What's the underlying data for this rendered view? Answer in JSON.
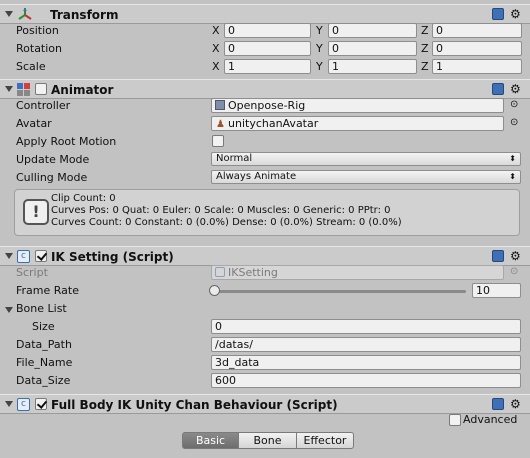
{
  "transform": {
    "title": "Transform",
    "rows": [
      {
        "label": "Position",
        "x": "0",
        "y": "0",
        "z": "0"
      },
      {
        "label": "Rotation",
        "x": "0",
        "y": "0",
        "z": "0"
      },
      {
        "label": "Scale",
        "x": "1",
        "y": "1",
        "z": "1"
      }
    ]
  },
  "axes": {
    "x": "X",
    "y": "Y",
    "z": "Z"
  },
  "animator": {
    "title": "Animator",
    "controller_label": "Controller",
    "controller_value": "Openpose-Rig",
    "avatar_label": "Avatar",
    "avatar_value": "unitychanAvatar",
    "apply_root_motion_label": "Apply Root Motion",
    "update_mode_label": "Update Mode",
    "update_mode_value": "Normal",
    "culling_mode_label": "Culling Mode",
    "culling_mode_value": "Always Animate",
    "info": {
      "line1": "Clip Count: 0",
      "line2": "Curves Pos: 0 Quat: 0 Euler: 0 Scale: 0 Muscles: 0 Generic: 0 PPtr: 0",
      "line3": "Curves Count: 0 Constant: 0 (0.0%) Dense: 0 (0.0%) Stream: 0 (0.0%)"
    }
  },
  "ik": {
    "title": "IK Setting (Script)",
    "script_label": "Script",
    "script_value": "IKSetting",
    "frame_rate_label": "Frame Rate",
    "frame_rate_value": "10",
    "frame_rate_slider_fraction": 0.0,
    "bone_list_label": "Bone List",
    "size_label": "Size",
    "size_value": "0",
    "data_path_label": "Data_Path",
    "data_path_value": "/datas/",
    "file_name_label": "File_Name",
    "file_name_value": "3d_data",
    "data_size_label": "Data_Size",
    "data_size_value": "600"
  },
  "fullbody": {
    "title": "Full Body IK Unity Chan Behaviour (Script)",
    "advanced_label": "Advanced",
    "tabs": [
      "Basic",
      "Bone",
      "Effector"
    ],
    "selected_tab": "Basic"
  },
  "colors": {
    "accent_blue": "#3a6fb0",
    "selected_tab": "#7a7a7a"
  }
}
